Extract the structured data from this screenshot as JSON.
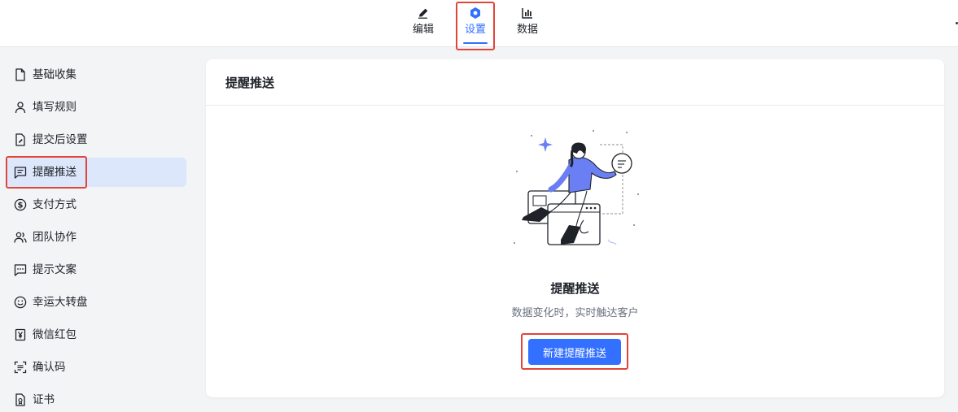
{
  "topnav": {
    "tabs": [
      {
        "label": "编辑",
        "icon": "pencil-icon"
      },
      {
        "label": "设置",
        "icon": "hexagon-settings-icon",
        "active": true
      },
      {
        "label": "数据",
        "icon": "bar-chart-icon"
      }
    ],
    "accent_color": "#3370ff",
    "highlight_color": "#e0453a"
  },
  "sidebar": {
    "items": [
      {
        "label": "基础收集",
        "icon": "file-icon"
      },
      {
        "label": "填写规则",
        "icon": "user-icon"
      },
      {
        "label": "提交后设置",
        "icon": "file-edit-icon"
      },
      {
        "label": "提醒推送",
        "icon": "message-square-icon",
        "active": true
      },
      {
        "label": "支付方式",
        "icon": "dollar-circle-icon"
      },
      {
        "label": "团队协作",
        "icon": "users-icon"
      },
      {
        "label": "提示文案",
        "icon": "message-dots-icon"
      },
      {
        "label": "幸运大转盘",
        "icon": "smile-icon"
      },
      {
        "label": "微信红包",
        "icon": "yen-icon"
      },
      {
        "label": "确认码",
        "icon": "scan-text-icon"
      },
      {
        "label": "证书",
        "icon": "certificate-icon"
      }
    ]
  },
  "main": {
    "card_title": "提醒推送",
    "empty_state": {
      "title": "提醒推送",
      "description": "数据变化时，实时触达客户",
      "button_label": "新建提醒推送"
    }
  }
}
